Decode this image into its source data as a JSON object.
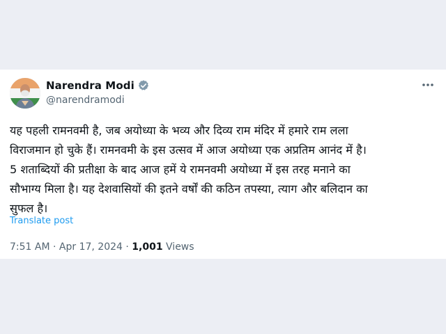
{
  "author": {
    "name": "Narendra Modi",
    "handle": "@narendramodi",
    "verified": true
  },
  "icons": {
    "verified": "verified-badge-icon",
    "more": "more-options-icon",
    "avatar": "profile-photo"
  },
  "post": {
    "lines": [
      "यह पहली रामनवमी है, जब अयोध्या के भव्य और दिव्य राम मंदिर में हमारे राम लला",
      "विराजमान हो चुके हैं। रामनवमी के इस उत्सव में आज अयोध्या एक अप्रतिम आनंद में है।",
      "5 शताब्दियों की प्रतीक्षा के बाद आज हमें ये रामनवमी अयोध्या में इस तरह मनाने का",
      "सौभाग्य मिला है। यह देशवासियों की इतने वर्षों की कठिन तपस्या, त्याग और बलिदान का",
      "सुफल है।"
    ],
    "translate_label": "Translate post"
  },
  "meta": {
    "time": "7:51 AM",
    "sep1": " · ",
    "date": "Apr 17, 2024",
    "sep2": " · ",
    "views_count": "1,001",
    "views_label": " Views"
  },
  "colors": {
    "background": "#eceef4",
    "card": "#ffffff",
    "text": "#0f1419",
    "muted": "#536471",
    "link": "#1d9bf0",
    "verified": "#829aab"
  }
}
